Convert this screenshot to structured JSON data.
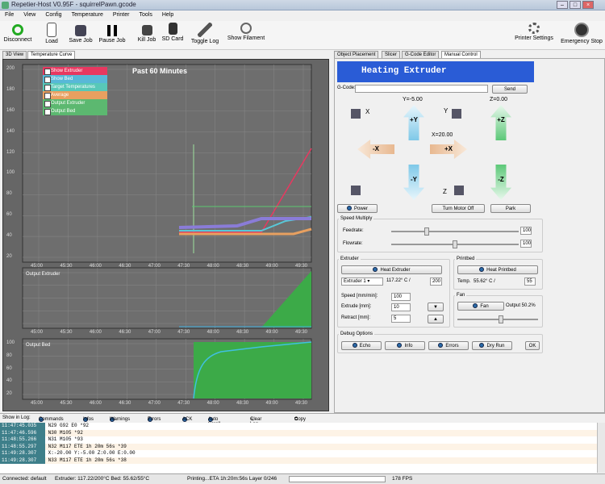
{
  "window": {
    "title": "Repetier-Host V0.95F - squirrelPawn.gcode"
  },
  "menu": [
    "File",
    "View",
    "Config",
    "Temperature",
    "Printer",
    "Tools",
    "Help"
  ],
  "toolbar": {
    "disconnect": "Disconnect",
    "load": "Load",
    "save_job": "Save Job",
    "pause_job": "Pause Job",
    "kill_job": "Kill Job",
    "sd_card": "SD Card",
    "toggle_log": "Toggle Log",
    "show_filament": "Show Filament",
    "printer_settings": "Printer Settings",
    "emergency_stop": "Emergency Stop"
  },
  "left_tabs": [
    "3D View",
    "Temperature Curve"
  ],
  "right_tabs": [
    "Object Placement",
    "Slicer",
    "G-Code Editor",
    "Manual Control"
  ],
  "temp": {
    "title": "Past 60 Minutes",
    "legend": [
      "Show Extruder",
      "Show Bed",
      "Target Temperatures",
      "Average",
      "Output Extruder",
      "Output Bed"
    ],
    "legend_colors": [
      "#e83860",
      "#58b8d8",
      "#58c8b8",
      "#e8a060",
      "#5cb870",
      "#5cb870"
    ],
    "y_ticks": [
      "200",
      "180",
      "160",
      "140",
      "120",
      "100",
      "80",
      "60",
      "40",
      "20"
    ],
    "x_ticks": [
      "45:00",
      "45:30",
      "46:00",
      "46:30",
      "47:00",
      "47:30",
      "48:00",
      "48:30",
      "49:00",
      "49:30"
    ],
    "out_extruder": "Output Extruder",
    "out_bed": "Output Bed",
    "y2_ticks": [
      "100",
      "80",
      "60",
      "40",
      "20"
    ]
  },
  "manual": {
    "header": "Heating Extruder",
    "gcode_label": "G-Code:",
    "send": "Send",
    "y_readout": "Y=-5.00",
    "z_readout": "Z=0.00",
    "x_readout": "X=20.00",
    "x_home": "X",
    "y_home": "Y",
    "z_home": "Z",
    "plus_y": "+Y",
    "minus_y": "-Y",
    "plus_x": "+X",
    "minus_x": "-X",
    "plus_z": "+Z",
    "minus_z": "-Z",
    "power": "Power",
    "turn_motor_off": "Turn Motor Off",
    "park": "Park",
    "speed_multiply": "Speed Multiply",
    "feedrate": "Feedrate:",
    "flowrate": "Flowrate:",
    "feed_val": "100",
    "flow_val": "100",
    "extruder_grp": "Extruder",
    "heat_extruder": "Heat Extruder",
    "extruder_sel": "Extruder 1",
    "extruder_temp": "117.22° C /",
    "extruder_target": "200",
    "speed_label": "Speed [mm/min]:",
    "speed_val": "100",
    "extrude_label": "Extrude [mm]:",
    "extrude_val": "10",
    "retract_label": "Retract [mm]:",
    "retract_val": "5",
    "printbed_grp": "Printbed",
    "heat_printbed": "Heat Printbed",
    "temp_label": "Temp.",
    "bed_temp": "55.62° C /",
    "bed_target": "55",
    "fan_grp": "Fan",
    "fan": "Fan",
    "fan_output": "Output 50.2%",
    "debug_grp": "Debug Options",
    "echo": "Echo",
    "info": "Info",
    "errors": "Errors",
    "dry_run": "Dry Run",
    "ok": "OK"
  },
  "logbar": {
    "show_in_log": "Show in Log:",
    "commands": "Commands",
    "infos": "Infos",
    "warnings": "Warnings",
    "errors": "Errors",
    "ack": "ACK",
    "auto_scroll": "Auto Scroll",
    "clear_log": "Clear Log",
    "copy": "Copy"
  },
  "log": [
    {
      "t": "11:47:45.035",
      "m": "N29 G92 E0 *92"
    },
    {
      "t": "11:47:46.596",
      "m": "N30 M105 *92"
    },
    {
      "t": "11:48:55.266",
      "m": "N31 M105 *93"
    },
    {
      "t": "11:48:55.297",
      "m": "N32 M117 ETE 1h 20m 56s *39"
    },
    {
      "t": "11:49:28.307",
      "m": "X:-20.00 Y:-5.00 Z:0.00 E:0.00"
    },
    {
      "t": "11:49:28.307",
      "m": "N33 M117 ETE 1h 20m 56s *38"
    }
  ],
  "status": {
    "conn": "Connected: default",
    "temps": "Extruder: 117.22/200°C Bed: 55.62/55°C",
    "job": "Printing...ETA 1h:20m:56s Layer 0/246",
    "fps": "178 FPS"
  }
}
